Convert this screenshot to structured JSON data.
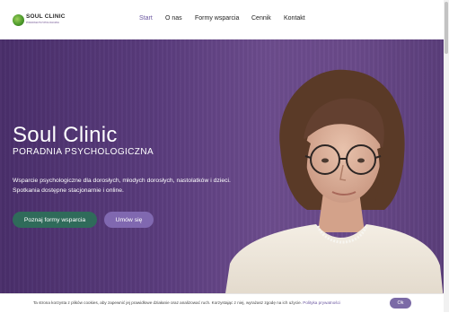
{
  "brand": {
    "name": "SOUL CLINIC",
    "tagline": "PORADNIA PSYCHOLOGICZNA"
  },
  "nav": {
    "items": [
      "Start",
      "O nas",
      "Formy wsparcia",
      "Cennik",
      "Kontakt"
    ],
    "active": "Start"
  },
  "hero": {
    "title": "Soul Clinic",
    "subtitle": "PORADNIA PSYCHOLOGICZNA",
    "text_line1": "Wsparcie psychologiczne dla dorosłych, młodych dorosłych, nastolatków i dzieci.",
    "text_line2": "Spotkania dostępne stacjonarnie i online.",
    "primary_button": "Poznaj formy wsparcia",
    "secondary_button": "Umów się"
  },
  "cookie": {
    "text": "Ta strona korzysta z plików cookies, aby zapewnić jej prawidłowe działanie oraz analizować ruch. Korzystając z niej, wyrażasz zgodę na ich użycie.",
    "link": "Polityka prywatności",
    "ok": "Ok"
  },
  "colors": {
    "accent": "#6b57a0",
    "primary_button": "#2f6b5a",
    "secondary_button": "#8068b0",
    "hero_background": "#5a3c7d"
  },
  "icons": {
    "logo": "soul-clinic-logo-icon"
  }
}
